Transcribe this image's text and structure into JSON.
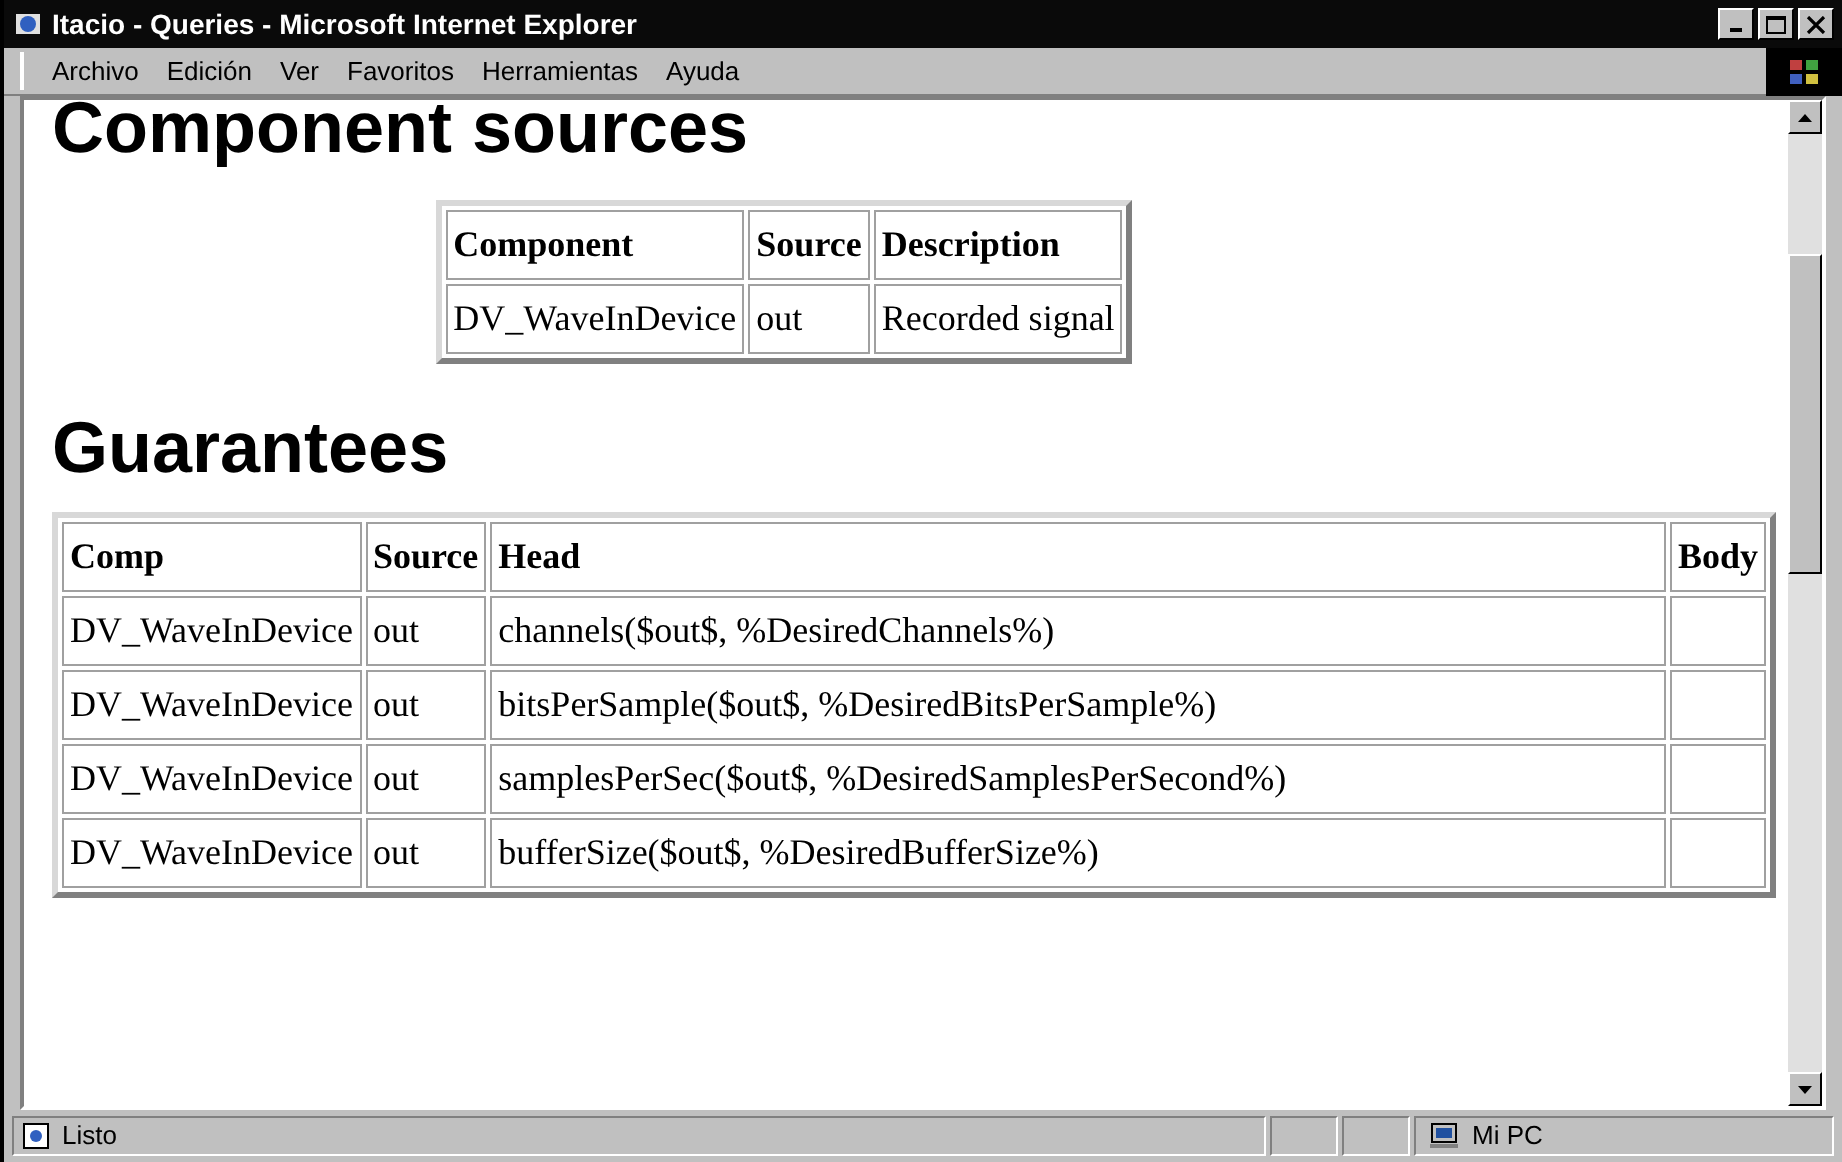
{
  "window": {
    "title": "Itacio - Queries - Microsoft Internet Explorer"
  },
  "menu": [
    "Archivo",
    "Edición",
    "Ver",
    "Favoritos",
    "Herramientas",
    "Ayuda"
  ],
  "sections": [
    {
      "heading": "Component sources",
      "table": {
        "columns": [
          "Component",
          "Source",
          "Description"
        ],
        "rows": [
          [
            "DV_WaveInDevice",
            "out",
            "Recorded signal"
          ]
        ]
      }
    },
    {
      "heading": "Guarantees",
      "table": {
        "columns": [
          "Comp",
          "Source",
          "Head",
          "Body"
        ],
        "rows": [
          [
            "DV_WaveInDevice",
            "out",
            "channels($out$, %DesiredChannels%)",
            ""
          ],
          [
            "DV_WaveInDevice",
            "out",
            "bitsPerSample($out$, %DesiredBitsPerSample%)",
            ""
          ],
          [
            "DV_WaveInDevice",
            "out",
            "samplesPerSec($out$, %DesiredSamplesPerSecond%)",
            ""
          ],
          [
            "DV_WaveInDevice",
            "out",
            "bufferSize($out$, %DesiredBufferSize%)",
            ""
          ]
        ]
      }
    }
  ],
  "status_bar": {
    "text": "Listo",
    "zone": "Mi PC"
  }
}
